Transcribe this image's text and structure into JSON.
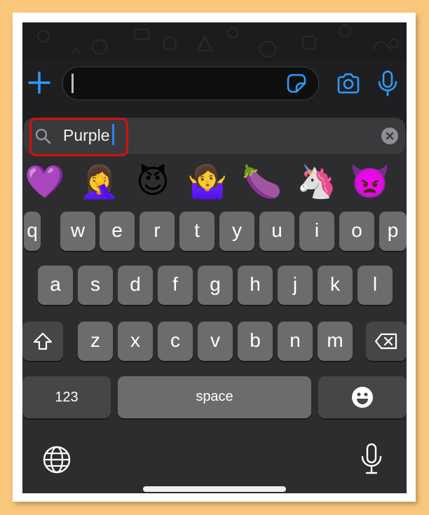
{
  "emoji_search": {
    "query": "Purple"
  },
  "emoji_results": [
    {
      "name": "purple-heart",
      "glyph": "💜"
    },
    {
      "name": "facepalm-woman",
      "glyph": "🤦‍♀️"
    },
    {
      "name": "smiling-devil",
      "glyph": "😈"
    },
    {
      "name": "shrug-woman",
      "glyph": "🤷‍♀️"
    },
    {
      "name": "eggplant",
      "glyph": "🍆"
    },
    {
      "name": "unicorn",
      "glyph": "🦄"
    },
    {
      "name": "angry-devil",
      "glyph": "👿"
    }
  ],
  "keyboard": {
    "row1": [
      "q",
      "w",
      "e",
      "r",
      "t",
      "y",
      "u",
      "i",
      "o",
      "p"
    ],
    "row2": [
      "a",
      "s",
      "d",
      "f",
      "g",
      "h",
      "j",
      "k",
      "l"
    ],
    "row3": [
      "z",
      "x",
      "c",
      "v",
      "b",
      "n",
      "m"
    ],
    "numbers_label": "123",
    "space_label": "space"
  },
  "colors": {
    "accent": "#2f9bff",
    "highlight": "#d50f0f",
    "background": "#f9c77b"
  },
  "icons": [
    "plus-icon",
    "sticker-icon",
    "camera-icon",
    "microphone-icon",
    "search-icon",
    "clear-icon",
    "shift-icon",
    "backspace-icon",
    "emoji-icon",
    "globe-icon",
    "dictation-icon"
  ]
}
